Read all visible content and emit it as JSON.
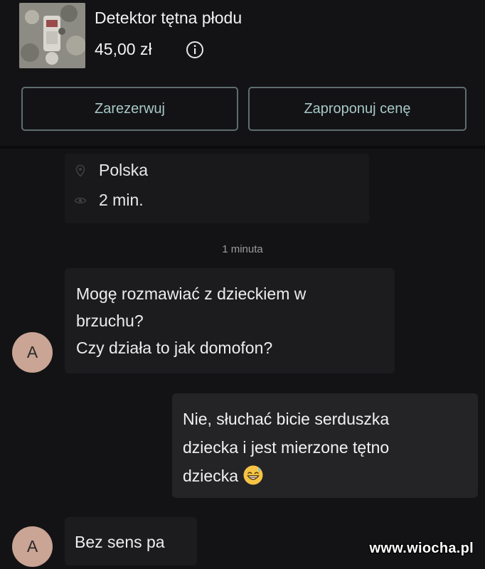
{
  "product": {
    "title": "Detektor tętna płodu",
    "price": "45,00 zł",
    "info_icon": "info-circle-icon"
  },
  "actions": {
    "reserve_label": "Zarezerwuj",
    "offer_label": "Zaproponuj cenę",
    "accent_color": "#5f6d6e"
  },
  "listing": {
    "location": "Polska",
    "location_icon": "location-pin-icon",
    "views_time": "2 min.",
    "views_icon": "eye-icon"
  },
  "chat": {
    "timestamp": "1 minuta",
    "messages": [
      {
        "sender": "incoming",
        "avatar": "A",
        "lines": [
          "Mogę rozmawiać z dzieckiem w",
          "brzuchu?",
          "Czy działa to jak domofon?"
        ]
      },
      {
        "sender": "outgoing",
        "lines": [
          "Nie, słuchać bicie serduszka",
          "dziecka i jest mierzone tętno",
          "dziecka"
        ],
        "emoji": "grinning-sweat-emoji"
      },
      {
        "sender": "incoming",
        "avatar": "A",
        "lines": [
          "Bez sens pa"
        ]
      }
    ]
  },
  "watermark": "www.wiocha.pl"
}
